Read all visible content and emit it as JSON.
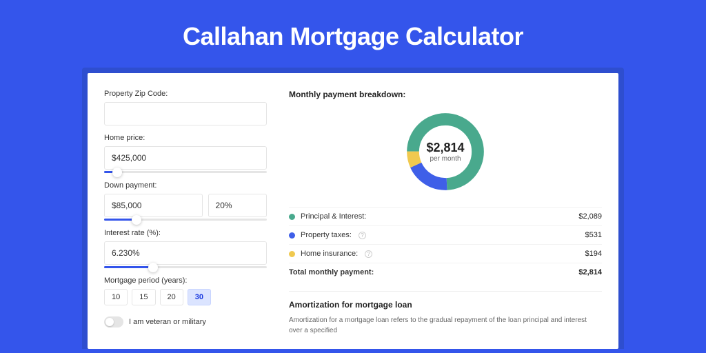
{
  "title": "Callahan Mortgage Calculator",
  "form": {
    "zip": {
      "label": "Property Zip Code:",
      "value": ""
    },
    "price": {
      "label": "Home price:",
      "value": "$425,000",
      "slider_pct": 8
    },
    "down": {
      "label": "Down payment:",
      "value": "$85,000",
      "pct": "20%",
      "slider_pct": 20
    },
    "rate": {
      "label": "Interest rate (%):",
      "value": "6.230%",
      "slider_pct": 30
    },
    "period": {
      "label": "Mortgage period (years):",
      "options": [
        "10",
        "15",
        "20",
        "30"
      ],
      "active": "30"
    },
    "veteran": {
      "label": "I am veteran or military",
      "on": false
    }
  },
  "breakdown": {
    "title": "Monthly payment breakdown:",
    "center_amount": "$2,814",
    "center_sub": "per month",
    "items": [
      {
        "label": "Principal & Interest:",
        "value": "$2,089",
        "color": "green"
      },
      {
        "label": "Property taxes:",
        "value": "$531",
        "color": "blue",
        "help": true
      },
      {
        "label": "Home insurance:",
        "value": "$194",
        "color": "yellow",
        "help": true
      }
    ],
    "total_label": "Total monthly payment:",
    "total_value": "$2,814"
  },
  "chart_data": {
    "type": "pie",
    "title": "Monthly payment breakdown",
    "series": [
      {
        "name": "Principal & Interest",
        "value": 2089,
        "color": "#49a98d"
      },
      {
        "name": "Property taxes",
        "value": 531,
        "color": "#3f5fe8"
      },
      {
        "name": "Home insurance",
        "value": 194,
        "color": "#f0c94f"
      }
    ],
    "total": 2814,
    "unit": "$ per month"
  },
  "amort": {
    "title": "Amortization for mortgage loan",
    "body": "Amortization for a mortgage loan refers to the gradual repayment of the loan principal and interest over a specified"
  }
}
